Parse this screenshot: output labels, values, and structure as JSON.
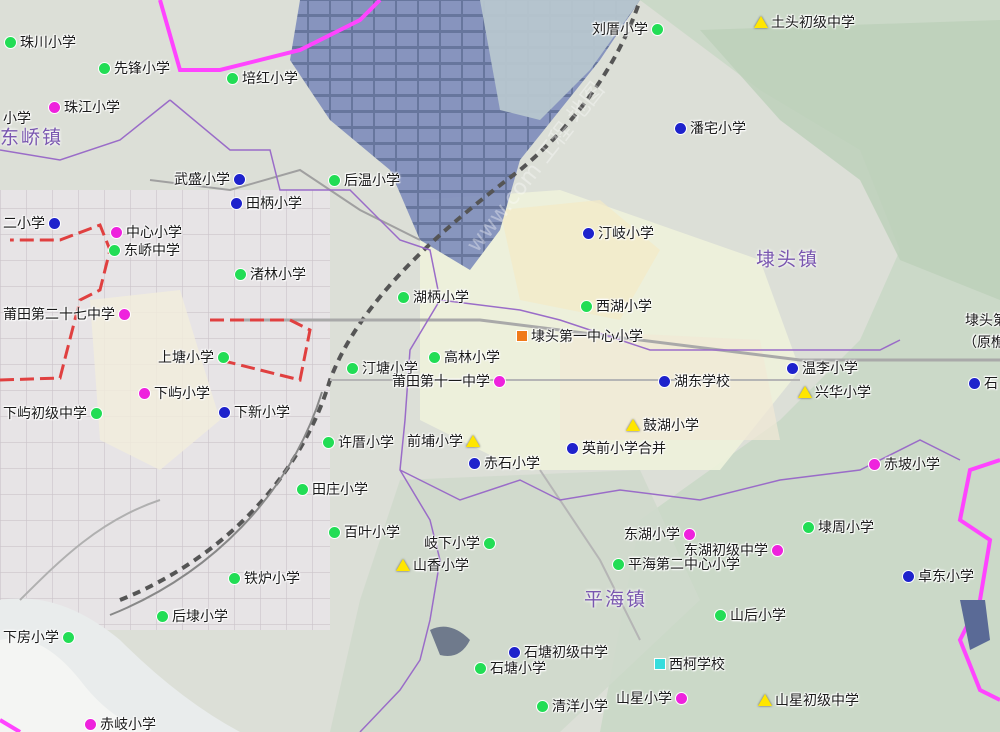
{
  "colors": {
    "green": "#22dd55",
    "blue": "#1e22cc",
    "magenta": "#ee22dd",
    "yellow": "#ffe600",
    "orange": "#f07a1a",
    "cyan": "#36dddd",
    "boundary": "#ff44ff",
    "district": "#e04040",
    "town_label": "#7a57b0"
  },
  "towns": [
    {
      "name": "东峤镇"
    },
    {
      "name": "埭头镇"
    },
    {
      "name": "平海镇"
    }
  ],
  "watermark": "www.com 工程 地图",
  "schools": [
    {
      "name": "珠川小学",
      "marker": "circle",
      "color": "green"
    },
    {
      "name": "先锋小学",
      "marker": "circle",
      "color": "green"
    },
    {
      "name": "培红小学",
      "marker": "circle",
      "color": "green"
    },
    {
      "name": "小学",
      "marker": "none",
      "color": ""
    },
    {
      "name": "珠江小学",
      "marker": "circle",
      "color": "magenta"
    },
    {
      "name": "刘厝小学",
      "marker": "circle",
      "color": "green"
    },
    {
      "name": "土头初级中学",
      "marker": "triangle",
      "color": "yellow"
    },
    {
      "name": "潘宅小学",
      "marker": "circle",
      "color": "blue"
    },
    {
      "name": "武盛小学",
      "marker": "circle",
      "color": "blue"
    },
    {
      "name": "后温小学",
      "marker": "circle",
      "color": "green"
    },
    {
      "name": "田柄小学",
      "marker": "circle",
      "color": "blue"
    },
    {
      "name": "二小学",
      "marker": "circle",
      "color": "blue"
    },
    {
      "name": "中心小学",
      "marker": "circle",
      "color": "magenta"
    },
    {
      "name": "东峤中学",
      "marker": "circle",
      "color": "green"
    },
    {
      "name": "汀岐小学",
      "marker": "circle",
      "color": "blue"
    },
    {
      "name": "渚林小学",
      "marker": "circle",
      "color": "green"
    },
    {
      "name": "湖柄小学",
      "marker": "circle",
      "color": "green"
    },
    {
      "name": "西湖小学",
      "marker": "circle",
      "color": "green"
    },
    {
      "name": "莆田第二十七中学",
      "marker": "circle",
      "color": "magenta"
    },
    {
      "name": "埭头第一中心小学",
      "marker": "square",
      "color": "orange"
    },
    {
      "name": "上塘小学",
      "marker": "circle",
      "color": "green"
    },
    {
      "name": "汀塘小学",
      "marker": "circle",
      "color": "green"
    },
    {
      "name": "高林小学",
      "marker": "circle",
      "color": "green"
    },
    {
      "name": "莆田第十一中学",
      "marker": "circle",
      "color": "magenta"
    },
    {
      "name": "温李小学",
      "marker": "circle",
      "color": "blue"
    },
    {
      "name": "湖东学校",
      "marker": "circle",
      "color": "blue"
    },
    {
      "name": "兴华小学",
      "marker": "triangle",
      "color": "yellow"
    },
    {
      "name": "下屿小学",
      "marker": "circle",
      "color": "magenta"
    },
    {
      "name": "下屿初级中学",
      "marker": "circle",
      "color": "green"
    },
    {
      "name": "下新小学",
      "marker": "circle",
      "color": "blue"
    },
    {
      "name": "鼓湖小学",
      "marker": "triangle",
      "color": "yellow"
    },
    {
      "name": "许厝小学",
      "marker": "circle",
      "color": "green"
    },
    {
      "name": "前埔小学",
      "marker": "triangle",
      "color": "yellow"
    },
    {
      "name": "英前小学合并",
      "marker": "circle",
      "color": "blue"
    },
    {
      "name": "赤石小学",
      "marker": "circle",
      "color": "blue"
    },
    {
      "name": "赤坡小学",
      "marker": "circle",
      "color": "magenta"
    },
    {
      "name": "田庄小学",
      "marker": "circle",
      "color": "green"
    },
    {
      "name": "东湖小学",
      "marker": "circle",
      "color": "magenta"
    },
    {
      "name": "埭周小学",
      "marker": "circle",
      "color": "green"
    },
    {
      "name": "东湖初级中学",
      "marker": "circle",
      "color": "magenta"
    },
    {
      "name": "百叶小学",
      "marker": "circle",
      "color": "green"
    },
    {
      "name": "岐下小学",
      "marker": "circle",
      "color": "green"
    },
    {
      "name": "平海第二中心小学",
      "marker": "circle",
      "color": "green"
    },
    {
      "name": "山香小学",
      "marker": "triangle",
      "color": "yellow"
    },
    {
      "name": "铁炉小学",
      "marker": "circle",
      "color": "green"
    },
    {
      "name": "卓东小学",
      "marker": "circle",
      "color": "blue"
    },
    {
      "name": "后埭小学",
      "marker": "circle",
      "color": "green"
    },
    {
      "name": "山后小学",
      "marker": "circle",
      "color": "green"
    },
    {
      "name": "下房小学",
      "marker": "circle",
      "color": "green"
    },
    {
      "name": "石塘初级中学",
      "marker": "circle",
      "color": "blue"
    },
    {
      "name": "西柯学校",
      "marker": "square",
      "color": "cyan"
    },
    {
      "name": "石塘小学",
      "marker": "circle",
      "color": "green"
    },
    {
      "name": "山星小学",
      "marker": "circle",
      "color": "magenta"
    },
    {
      "name": "山星初级中学",
      "marker": "triangle",
      "color": "yellow"
    },
    {
      "name": "清洋小学",
      "marker": "circle",
      "color": "green"
    },
    {
      "name": "赤岐小学",
      "marker": "circle",
      "color": "magenta"
    },
    {
      "name": "埭头第",
      "marker": "none",
      "color": ""
    },
    {
      "name": "（原樵",
      "marker": "none",
      "color": ""
    },
    {
      "name": "石",
      "marker": "circle",
      "color": "blue"
    }
  ]
}
